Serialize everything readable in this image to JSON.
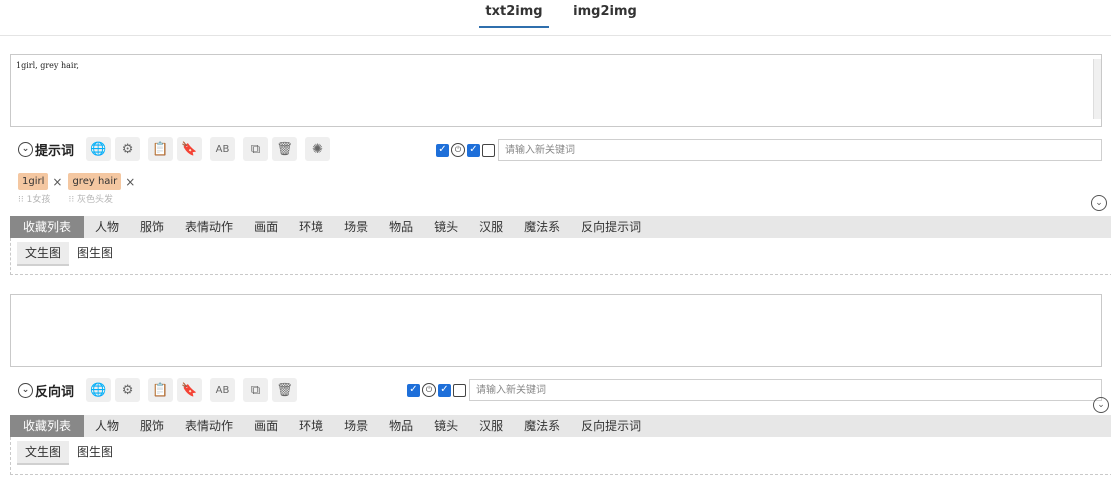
{
  "top_tabs": [
    {
      "label": "txt2img",
      "active": true
    },
    {
      "label": "img2img",
      "active": false
    }
  ],
  "prompt": {
    "value": "1girl, grey hair,",
    "label": "提示词",
    "keyword_placeholder": "请输入新关键词",
    "tags": [
      {
        "label": "1girl",
        "translation": "1女孩"
      },
      {
        "label": "grey hair",
        "translation": "灰色头发"
      }
    ]
  },
  "negative": {
    "value": "",
    "label": "反向词",
    "keyword_placeholder": "请输入新关键词"
  },
  "toolbar_icons": [
    "translate-icon",
    "settings-icon",
    "history-icon",
    "bookmark-icon",
    "spellcheck-icon",
    "copy-icon",
    "delete-icon",
    "openai-icon"
  ],
  "categories": [
    "收藏列表",
    "人物",
    "服饰",
    "表情动作",
    "画面",
    "环境",
    "场景",
    "物品",
    "镜头",
    "汉服",
    "魔法系",
    "反向提示词"
  ],
  "subtabs": [
    "文生图",
    "图生图"
  ],
  "colors": {
    "accent": "#1e6fd9",
    "tag_bg": "#f4c7a1",
    "active_category_bg": "#888888",
    "tab_underline": "#2f6fad"
  }
}
